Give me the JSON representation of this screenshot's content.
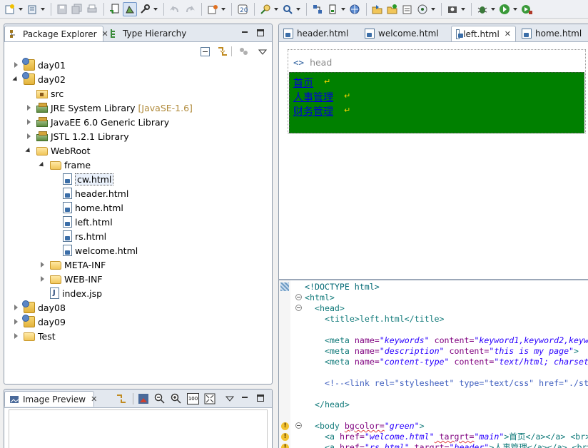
{
  "toolbar": {
    "icons": [
      "new-wizard-icon",
      "new-icon",
      "save-icon",
      "save-all-icon",
      "print-icon",
      "deploy-icon",
      "run-server-icon",
      "tools-icon",
      "back-icon",
      "forward-icon",
      "build-icon",
      "open-type-icon",
      "search-icon",
      "find-icon",
      "project-icon",
      "server-icon",
      "web-icon",
      "open-file-icon",
      "new-file-icon",
      "task-icon",
      "open-view-icon",
      "camera-icon",
      "debug-icon",
      "run-icon",
      "external-tools-icon"
    ]
  },
  "package_explorer": {
    "tab_label": "Package Explorer",
    "tab2_label": "Type Hierarchy",
    "tree": [
      {
        "label": "day01",
        "decor": ""
      },
      {
        "label": "day02",
        "decor": ""
      },
      {
        "label": "src",
        "decor": ""
      },
      {
        "label": "JRE System Library",
        "decor": "[JavaSE-1.6]"
      },
      {
        "label": "JavaEE 6.0 Generic Library",
        "decor": ""
      },
      {
        "label": "JSTL 1.2.1 Library",
        "decor": ""
      },
      {
        "label": "WebRoot",
        "decor": ""
      },
      {
        "label": "frame",
        "decor": ""
      },
      {
        "label": "cw.html",
        "decor": ""
      },
      {
        "label": "header.html",
        "decor": ""
      },
      {
        "label": "home.html",
        "decor": ""
      },
      {
        "label": "left.html",
        "decor": ""
      },
      {
        "label": "rs.html",
        "decor": ""
      },
      {
        "label": "welcome.html",
        "decor": ""
      },
      {
        "label": "META-INF",
        "decor": ""
      },
      {
        "label": "WEB-INF",
        "decor": ""
      },
      {
        "label": "index.jsp",
        "decor": ""
      },
      {
        "label": "day08",
        "decor": ""
      },
      {
        "label": "day09",
        "decor": ""
      },
      {
        "label": "Test",
        "decor": ""
      }
    ]
  },
  "image_preview": {
    "tab_label": "Image Preview",
    "zoom_label": "100"
  },
  "editor": {
    "tabs": [
      {
        "label": "header.html"
      },
      {
        "label": "welcome.html"
      },
      {
        "label": "left.html"
      },
      {
        "label": "home.html"
      }
    ],
    "design": {
      "head_tag": "<>",
      "head_label": "head",
      "links": [
        "首页",
        "人事管理",
        "财务管理"
      ],
      "body_color": "#008000"
    },
    "source": {
      "doctype": "<!DOCTYPE html>",
      "html_open": "<html>",
      "head_open": "<head>",
      "title_line": "<title>left.html</title>",
      "meta1": {
        "tag": "<meta ",
        "name_attr": "name=",
        "name_val": "\"keywords\"",
        "content_attr": " content=",
        "content_val": "\"keyword1,keyword2,keyw"
      },
      "meta2": {
        "tag": "<meta ",
        "name_attr": "name=",
        "name_val": "\"description\"",
        "content_attr": " content=",
        "content_val": "\"this is my page\"",
        "end": ">"
      },
      "meta3": {
        "tag": "<meta ",
        "name_attr": "name=",
        "name_val": "\"content-type\"",
        "content_attr": " content=",
        "content_val": "\"text/html; charset"
      },
      "comment": "<!--<link rel=\"stylesheet\" type=\"text/css\" href=\"./st",
      "head_close": "</head>",
      "body_line": {
        "tag": "<body ",
        "attr": "bgcolor=",
        "val": "\"green\"",
        "end": ">"
      },
      "a1": {
        "tag": "<a ",
        "href": "href=",
        "href_val": "\"welcome.html\"",
        "t": " targrt=",
        "t_val": "\"main\"",
        "text": ">首页</a></a> <br>"
      },
      "a2": {
        "tag": "<a ",
        "href": "href=",
        "href_val": "\"rs.html\"",
        "t": " targrt=",
        "t_val": "\"header\"",
        "text": ">人事管理</a></a> <br>"
      }
    }
  }
}
